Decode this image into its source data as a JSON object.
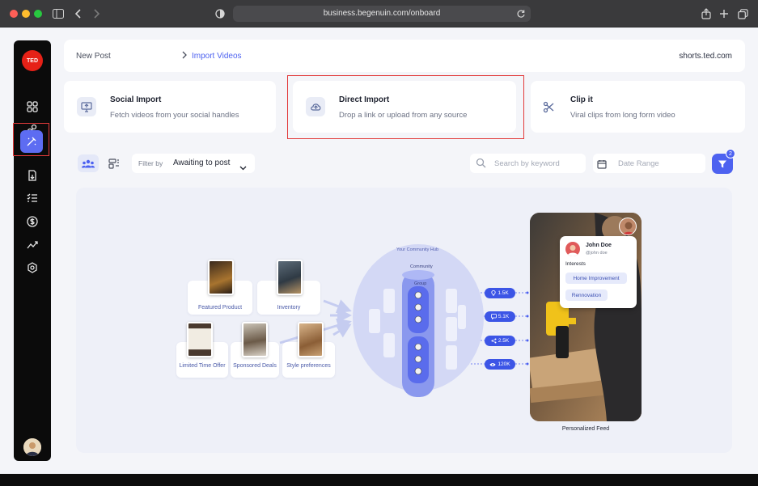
{
  "browser": {
    "url": "business.begenuin.com/onboard"
  },
  "sidebar": {
    "logo": "TED",
    "items": [
      {
        "icon": "grid-icon"
      },
      {
        "icon": "community-icon"
      },
      {
        "icon": "magic-wand-icon",
        "active": true
      },
      {
        "icon": "import-icon"
      },
      {
        "icon": "list-icon"
      },
      {
        "icon": "dollar-icon"
      },
      {
        "icon": "analytics-icon"
      },
      {
        "icon": "settings-icon"
      }
    ]
  },
  "breadcrumb": {
    "root": "New Post",
    "current": "Import Videos",
    "domain": "shorts.ted.com"
  },
  "options": [
    {
      "title": "Social Import",
      "subtitle": "Fetch videos from your social handles",
      "icon": "monitor-upload-icon"
    },
    {
      "title": "Direct Import",
      "subtitle": "Drop a link or upload from any source",
      "icon": "cloud-upload-icon"
    },
    {
      "title": "Clip it",
      "subtitle": "Viral clips from long form video",
      "icon": "scissors-icon"
    }
  ],
  "filters": {
    "filter_by_label": "Filter by",
    "filter_value": "Awaiting to post",
    "search_placeholder": "Search by keyword",
    "date_placeholder": "Date Range",
    "filter_count": "2"
  },
  "illustration": {
    "sources": [
      "Featured Product",
      "Inventory",
      "Limited Time Offer",
      "Sponsored Deals",
      "Style preferences"
    ],
    "hub_title": "Your Community Hub",
    "hub_community": "Community",
    "hub_group": "Group",
    "stats": [
      {
        "icon": "location-icon",
        "value": "1.5K"
      },
      {
        "icon": "chat-icon",
        "value": "5.1K"
      },
      {
        "icon": "share-icon",
        "value": "2.5K"
      },
      {
        "icon": "eye-icon",
        "value": "120K"
      }
    ],
    "profile": {
      "name": "John Doe",
      "handle": "@john doe",
      "interests_label": "Interests",
      "interests": [
        "Home Improvement",
        "Rennovation"
      ]
    },
    "feed_label": "Personalized Feed"
  },
  "colors": {
    "accent": "#4d62f0",
    "highlight": "#e23a3a",
    "sidebar": "#0b0b0b"
  }
}
